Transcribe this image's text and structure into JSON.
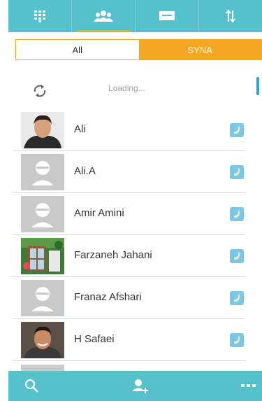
{
  "tabs": [
    {
      "icon": "dialpad-icon"
    },
    {
      "icon": "contacts-group-icon",
      "active": true
    },
    {
      "icon": "message-icon"
    },
    {
      "icon": "transfer-arrows-icon"
    }
  ],
  "segment": {
    "all_label": "All",
    "syna_label": "SYNA",
    "selected": "SYNA"
  },
  "loading": {
    "text": "Loading..."
  },
  "contacts": [
    {
      "name": "Ali",
      "avatar": "photo-man-dark-hair"
    },
    {
      "name": "Ali.A",
      "avatar": "default-avatar"
    },
    {
      "name": "Amir Amini",
      "avatar": "default-avatar"
    },
    {
      "name": "Farzaneh Jahani",
      "avatar": "photo-garden-window"
    },
    {
      "name": "Franaz Afshari",
      "avatar": "default-avatar"
    },
    {
      "name": "H Safaei",
      "avatar": "photo-man-smiling"
    }
  ],
  "bottombar": {
    "icons": [
      "search-icon",
      "add-contact-icon",
      "more-icon"
    ]
  },
  "colors": {
    "accent": "#56c1cc",
    "highlight": "#f5a623",
    "badge": "#7cc6e6"
  }
}
